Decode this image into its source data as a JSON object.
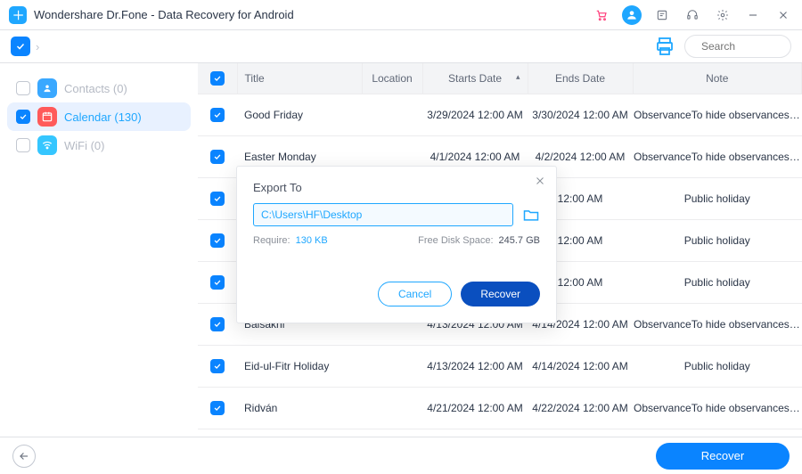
{
  "titlebar": {
    "title": "Wondershare Dr.Fone - Data Recovery for Android"
  },
  "toolbar": {
    "search_placeholder": "Search"
  },
  "sidebar": {
    "items": [
      {
        "label": "Contacts (0)"
      },
      {
        "label": "Calendar (130)"
      },
      {
        "label": "WiFi (0)"
      }
    ]
  },
  "table": {
    "headers": {
      "title": "Title",
      "location": "Location",
      "starts": "Starts Date",
      "ends": "Ends Date",
      "note": "Note"
    },
    "rows": [
      {
        "title": "Good Friday",
        "location": "",
        "starts": "3/29/2024 12:00 AM",
        "ends": "3/30/2024 12:00 AM",
        "note": "ObservanceTo hide observances, go to…"
      },
      {
        "title": "Easter Monday",
        "location": "",
        "starts": "4/1/2024 12:00 AM",
        "ends": "4/2/2024 12:00 AM",
        "note": "ObservanceTo hide observances, go to…"
      },
      {
        "title": "",
        "location": "",
        "starts": "",
        "ends": "12:00 AM",
        "note": "Public holiday"
      },
      {
        "title": "",
        "location": "",
        "starts": "",
        "ends": "12:00 AM",
        "note": "Public holiday"
      },
      {
        "title": "",
        "location": "",
        "starts": "",
        "ends": "12:00 AM",
        "note": "Public holiday"
      },
      {
        "title": "Baisakhi",
        "location": "",
        "starts": "4/13/2024 12:00 AM",
        "ends": "4/14/2024 12:00 AM",
        "note": "ObservanceTo hide observances, go to…"
      },
      {
        "title": "Eid-ul-Fitr Holiday",
        "location": "",
        "starts": "4/13/2024 12:00 AM",
        "ends": "4/14/2024 12:00 AM",
        "note": "Public holiday"
      },
      {
        "title": "Ridván",
        "location": "",
        "starts": "4/21/2024 12:00 AM",
        "ends": "4/22/2024 12:00 AM",
        "note": "ObservanceTo hide observances, go to…"
      }
    ]
  },
  "footer": {
    "recover": "Recover"
  },
  "modal": {
    "title": "Export To",
    "path": "C:\\Users\\HF\\Desktop",
    "require_label": "Require:",
    "require_value": "130 KB",
    "space_label": "Free Disk Space:",
    "space_value": "245.7 GB",
    "cancel": "Cancel",
    "recover": "Recover"
  }
}
